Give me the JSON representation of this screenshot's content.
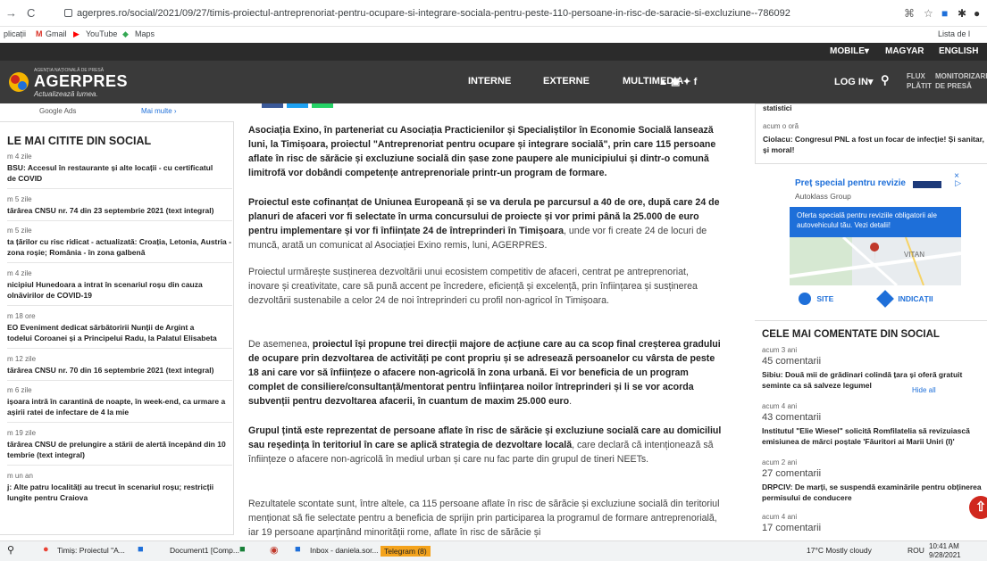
{
  "browser": {
    "url": "agerpres.ro/social/2021/09/27/timis-proiectul-antreprenoriat-pentru-ocupare-si-integrare-sociala-pentru-peste-110-persoane-in-risc-de-saracie-si-excluziune--786092",
    "bookmarks": [
      "plicații",
      "Gmail",
      "YouTube",
      "Maps"
    ],
    "reading_list": "Lista de l"
  },
  "langbar": {
    "mobile": "MOBILE▾",
    "magyar": "MAGYAR",
    "english": "ENGLISH"
  },
  "header": {
    "logo_small": "AGENȚIA NAȚIONALĂ DE PRESĂ",
    "logo_main": "AGERPRES",
    "logo_tag": "Actualizează lumea.",
    "nav": [
      "INTERNE",
      "EXTERNE",
      "MULTIMEDIA"
    ],
    "social": "▲ ▣ ✦ f",
    "login": "LOG IN▾",
    "flux": [
      "FLUX",
      "PLĂTIT"
    ],
    "monitor": [
      "MONITORIZARE",
      "DE PRESĂ"
    ]
  },
  "left": {
    "ads_label": "Google Ads",
    "ads_more": "Mai multe ›",
    "heading": "LE MAI CITITE DIN SOCIAL",
    "items": [
      {
        "time": "m 4 zile",
        "title": "BSU: Accesul în restaurante și alte locații - cu certificatul\nde COVID"
      },
      {
        "time": "m 5 zile",
        "title": "tărârea CNSU nr. 74 din 23 septembrie 2021 (text integral)"
      },
      {
        "time": "m 5 zile",
        "title": "ta țărilor cu risc ridicat - actualizată: Croația, Letonia, Austria -\nzona roșie; România - în zona galbenă"
      },
      {
        "time": "m 4 zile",
        "title": "nicipiul Hunedoara a intrat în scenariul roșu din cauza\nolnăvirilor de COVID-19"
      },
      {
        "time": "m 18 ore",
        "title": "EO Eveniment dedicat sărbătoririi Nunții de Argint a\ntodelui Coroanei și a Principelui Radu, la Palatul Elisabeta"
      },
      {
        "time": "m 12 zile",
        "title": "tărârea CNSU nr. 70 din 16 septembrie 2021 (text integral)"
      },
      {
        "time": "m 6 zile",
        "title": "ișoara intră în carantină de noapte, în week-end, ca urmare a\nașirii ratei de infectare de 4 la mie"
      },
      {
        "time": "m 19 zile",
        "title": "tărârea CNSU de prelungire a stării de alertă începând din 10\ntembrie (text integral)"
      },
      {
        "time": "m un an",
        "title": "j: Alte patru localități au trecut în scenariul roșu; restricții\nlungite pentru Craiova"
      }
    ]
  },
  "article": {
    "p1_bold": "Asociația Exino, în parteneriat cu Asociația Practicienilor și Specialiștilor în Economie Socială lansează luni, la Timișoara, proiectul \"Antreprenoriat pentru ocupare și integrare socială\", prin care 115 persoane aflate în risc de sărăcie și excluziune socială din șase zone paupere ale municipiului și dintr-o comună limitrofă vor dobândi competențe antreprenoriale printr-un program de formare.",
    "p2_bold": "Proiectul este cofinanțat de Uniunea Europeană și se va derula pe parcursul a 40 de ore, după care 24 de planuri de afaceri vor fi selectate în urma concursului de proiecte și vor primi până la 25.000 de euro pentru implementare și vor fi înființate 24 de întreprinderi în Timișoara",
    "p2_rest": ", unde vor fi create 24 de locuri de muncă, arată un comunicat al Asociației Exino remis, luni, AGERPRES.",
    "p3": "Proiectul urmărește susținerea dezvoltării unui ecosistem competitiv de afaceri, centrat pe antreprenoriat, inovare și creativitate, care să pună accent pe încredere, eficiență și excelență, prin înființarea și susținerea dezvoltării sustenabile a celor 24 de noi întreprinderi cu profil non-agricol în Timișoara.",
    "p4_a": "De asemenea, ",
    "p4_bold": "proiectul își propune trei direcții majore de acțiune care au ca scop final creșterea gradului de ocupare prin dezvoltarea de activități pe cont propriu și se adresează persoanelor cu vârsta de peste 18 ani care vor să înființeze o afacere non-agricolă în zona urbană. Ei vor beneficia de un program complet de consiliere/consultanță/mentorat pentru înființarea noilor întreprinderi și li se vor acorda subvenții pentru dezvoltarea afacerii, în cuantum de maxim 25.000 euro",
    "p4_end": ".",
    "p5_bold": "Grupul țintă este reprezentat de persoane aflate în risc de sărăcie și excluziune socială care au domiciliul sau reședința în teritoriul în care se aplică strategia de dezvoltare locală",
    "p5_rest": ", care declară că intenționează să înființeze o afacere non-agricolă în mediul urban și care nu fac parte din grupul de tineri NEETs.",
    "p6": "Rezultatele scontate sunt, între altele, ca 115 persoane aflate în risc de sărăcie și excluziune socială din teritoriul menționat să fie selectate pentru a beneficia de sprijin prin participarea la programul de formare antreprenorială, iar 19 persoane aparținând minorității rome, aflate în risc de sărăcie și"
  },
  "right": {
    "top_label": "statistici",
    "top_time": "acum o oră",
    "top_title": "Ciolacu: Congresul PNL a fost un focar de infecție! Și sanitar, și moral!",
    "ad": {
      "title": "Preț special pentru revizie",
      "advertiser": "Autoklass Group",
      "body": "Oferta specială pentru reviziile obligatorii ale autovehiculul tău. Vezi detalii!",
      "map_label": "VITAN",
      "site": "SITE",
      "directions": "INDICAȚII",
      "close": "×"
    },
    "comments_heading": "CELE MAI COMENTATE DIN SOCIAL",
    "hide_all": "Hide all",
    "comments": [
      {
        "time": "acum 3 ani",
        "count": "45 comentarii",
        "title": "Sibiu: Două mii de grădinari colindă țara și oferă gratuit seminte ca să salveze legumel"
      },
      {
        "time": "acum 4 ani",
        "count": "43 comentarii",
        "title": "Institutul \"Elie Wiesel\" solicită Romfilatelia să revizuiască emisiunea de mărci poștale 'Făuritori ai Marii Uniri (I)'"
      },
      {
        "time": "acum 2 ani",
        "count": "27 comentarii",
        "title": "DRPCIV: De marți, se suspendă examinările pentru obținerea permisului de conducere"
      },
      {
        "time": "acum 4 ani",
        "count": "17 comentarii",
        "title": ""
      }
    ]
  },
  "taskbar": {
    "items": [
      "Timiș: Proiectul \"A...",
      "Document1 [Comp...",
      "Inbox - daniela.sor...",
      "Telegram (8)"
    ],
    "weather": "17°C  Mostly cloudy",
    "lang": "ROU",
    "time": "10:41 AM",
    "date": "9/28/2021"
  },
  "colors": {
    "header": "#3a3a3a",
    "langbar": "#2b2b2b",
    "ad_blue": "#1e6fd9",
    "up_button": "#d0281e"
  }
}
